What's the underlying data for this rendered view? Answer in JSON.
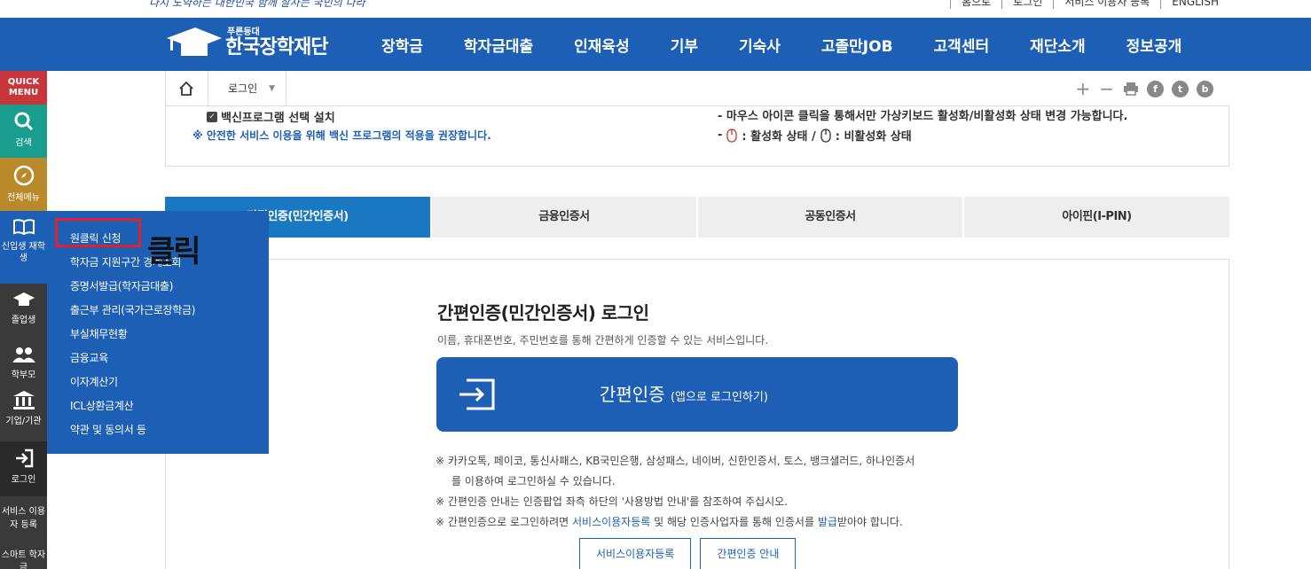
{
  "header": {
    "slogan": "다시 도약하는 대한민국 함께 잘사는 국민의 나라",
    "util_links": [
      "홈으로",
      "로그인",
      "서비스 이용자 등록",
      "ENGLISH"
    ]
  },
  "gnb": {
    "logo_small": "푸른등대",
    "logo_main": "한국장학재단",
    "menu": [
      "장학금",
      "학자금대출",
      "인재육성",
      "기부",
      "기숙사",
      "고졸만JOB",
      "고객센터",
      "재단소개",
      "정보공개"
    ]
  },
  "quick_menu": {
    "title": "QUICK MENU",
    "items": [
      "검색",
      "전체메뉴",
      "신입생 재학생",
      "졸업생",
      "학부모",
      "기업/기관",
      "로그인",
      "서비스 이용자 등록",
      "스마트 학자금"
    ]
  },
  "dropdown": {
    "items": [
      "원클릭 신청",
      "학자금 지원구간 경계조회",
      "증명서발급(학자금대출)",
      "출근부 관리(국가근로장학금)",
      "부실채무현황",
      "금융교육",
      "이자계산기",
      "ICL상환금계산",
      "약관 및 동의서 등"
    ],
    "annotation": "클릭"
  },
  "breadcrumb": {
    "current": "로그인",
    "tools": [
      "+",
      "−",
      "print-icon",
      "f",
      "t",
      "b"
    ]
  },
  "security": {
    "checkbox_label": "백신프로그램 선택 설치",
    "notice": "※ 안전한 서비스 이용을 위해 백신 프로그램의 적용을 권장합니다.",
    "right_line1": "- 마우스 아이콘 클릭을 통해서만 가상키보드 활성화/비활성화 상태 변경 가능합니다.",
    "right_line2_a": "- ",
    "right_line2_b": ": 활성화 상태 /",
    "right_line2_c": ": 비활성화 상태"
  },
  "tabs": [
    "간편인증(민간인증서)",
    "금융인증서",
    "공동인증서",
    "아이핀(I-PIN)"
  ],
  "login_panel": {
    "title": "간편인증(민간인증서) 로그인",
    "subtitle": "이름, 휴대폰번호, 주민번호를 통해 간편하게 인증할 수 있는 서비스입니다.",
    "main_button": "간편인증",
    "main_button_sub": "(앱으로 로그인하기)",
    "note1": "※ 카카오톡, 페이코, 통신사패스, KB국민은행, 삼성패스, 네이버, 신한인증서, 토스, 뱅크샐러드, 하나인증서",
    "note1b": "를 이용하여 로그인하실 수 있습니다.",
    "note2": "※ 간편인증 안내는 인증팝업 좌측 하단의 '사용방법 안내'를 참조하여 주십시오.",
    "note3_a": "※ 간편인증으로 로그인하려면 ",
    "note3_link1": "서비스이용자등록",
    "note3_b": " 및 해당 인증사업자를 통해 인증서를 ",
    "note3_link2": "발급",
    "note3_c": "받아야 합니다.",
    "buttons": [
      "서비스이용자등록",
      "간편인증 안내"
    ]
  },
  "colors": {
    "primary": "#1d5fb5",
    "tab_active": "#1a78c2",
    "accent_red": "#e0202a"
  }
}
